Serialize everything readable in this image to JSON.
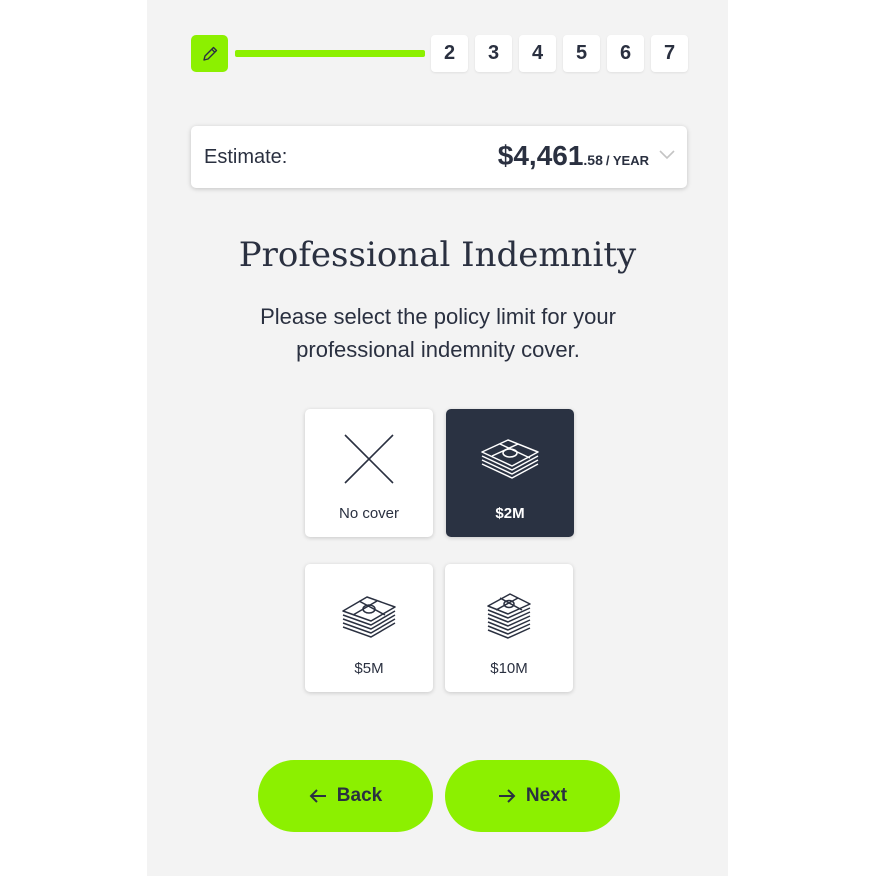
{
  "stepper": {
    "current_step_icon": "pencil-icon",
    "progress_color": "#8cf000",
    "steps": [
      "2",
      "3",
      "4",
      "5",
      "6",
      "7"
    ]
  },
  "estimate": {
    "label": "Estimate:",
    "amount": "$4,461",
    "cents": ".58",
    "period": "/ YEAR",
    "toggle_icon": "chevron-down-icon"
  },
  "page": {
    "title": "Professional Indemnity",
    "subtitle": "Please select the policy limit for your professional indemnity cover."
  },
  "options": [
    {
      "label": "No cover",
      "icon": "cross-icon",
      "selected": false
    },
    {
      "label": "$2M",
      "icon": "money-stack-icon",
      "selected": true
    },
    {
      "label": "$5M",
      "icon": "money-stack-icon",
      "selected": false
    },
    {
      "label": "$10M",
      "icon": "money-stack-icon",
      "selected": false
    }
  ],
  "nav": {
    "back_label": "Back",
    "next_label": "Next"
  },
  "colors": {
    "accent": "#8cf000",
    "dark": "#2a3242",
    "text": "#2a3040"
  }
}
